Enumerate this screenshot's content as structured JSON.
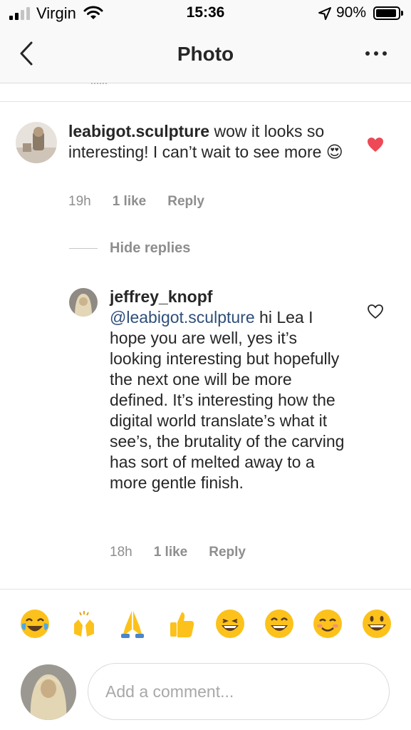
{
  "status_bar": {
    "carrier": "Virgin",
    "time": "15:36",
    "battery_percent": "90%",
    "battery_level": 0.9,
    "signal_bars": 2
  },
  "nav": {
    "title": "Photo",
    "back_icon": "chevron-left-icon",
    "more_icon": "more-horizontal-icon"
  },
  "comments": [
    {
      "username": "leabigot.sculpture",
      "text": " wow it looks so interesting! I can’t wait to see more ",
      "emoji": "😍",
      "time": "19h",
      "likes": "1 like",
      "reply_label": "Reply",
      "liked": true
    }
  ],
  "hide_replies_label": "Hide replies",
  "replies": [
    {
      "username": "jeffrey_knopf",
      "mention": "@leabigot.sculpture",
      "text": " hi Lea I hope you are well, yes it’s looking interesting but hopefully the next one will be more defined. It’s interesting how the digital world translate’s what it see’s, the brutality of the carving has sort of melted away to a more gentle finish.",
      "time": "18h",
      "likes": "1 like",
      "reply_label": "Reply",
      "liked": false
    }
  ],
  "quick_emojis": [
    "😂",
    "🙌",
    "🙏",
    "👍",
    "😁",
    "😄",
    "😊",
    "😀"
  ],
  "comment_input": {
    "placeholder": "Add a comment..."
  },
  "colors": {
    "like_red": "#ed4956",
    "mention_blue": "#2e4e7a",
    "meta_gray": "#8e8e8e"
  }
}
